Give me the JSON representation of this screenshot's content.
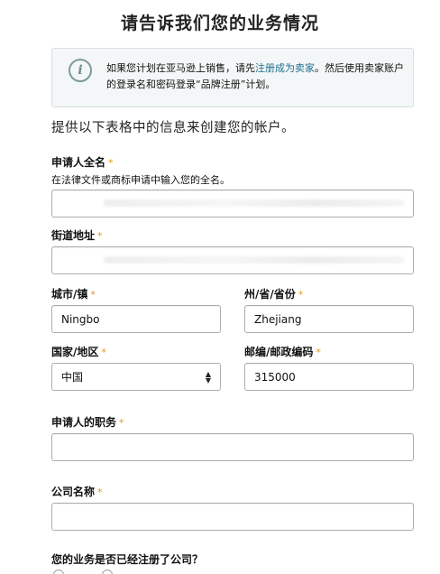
{
  "page": {
    "title": "请告诉我们您的业务情况"
  },
  "info": {
    "icon": "info-icon",
    "text_before": "如果您计划在亚马逊上销售，请先",
    "link": "注册成为卖家",
    "text_after": "。然后使用卖家账户的登录名和密码登录“品牌注册”计划。"
  },
  "form": {
    "intro": "提供以下表格中的信息来创建您的帐户。",
    "required_marker": "*",
    "full_name": {
      "label": "申请人全名",
      "hint": "在法律文件或商标申请中输入您的全名。",
      "value": ""
    },
    "street": {
      "label": "街道地址",
      "value": ""
    },
    "city": {
      "label": "城市/镇",
      "value": "Ningbo"
    },
    "state": {
      "label": "州/省/省份",
      "value": "Zhejiang"
    },
    "country": {
      "label": "国家/地区",
      "value": "中国"
    },
    "postal": {
      "label": "邮编/邮政编码",
      "value": "315000"
    },
    "job_title": {
      "label": "申请人的职务",
      "value": ""
    },
    "company": {
      "label": "公司名称",
      "value": ""
    },
    "registered_question": "您的业务是否已经注册了公司？"
  }
}
